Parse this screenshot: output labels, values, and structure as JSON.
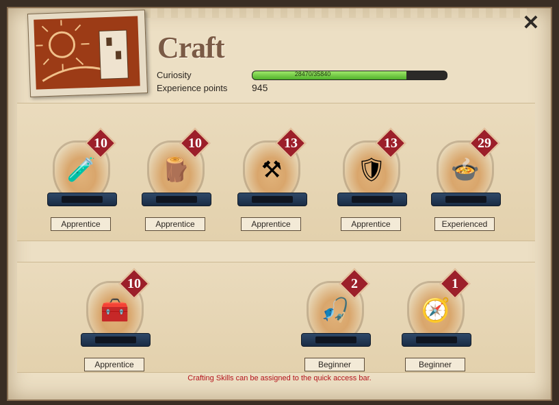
{
  "window": {
    "title": "Craft",
    "close_label": "✕",
    "curiosity_label": "Curiosity",
    "experience_label": "Experience points",
    "experience_value": "945",
    "curiosity_bar_text": "28470/35840",
    "curiosity_fraction": 0.794
  },
  "skills_row1": [
    {
      "level": "10",
      "rank": "Apprentice",
      "icon": "potion-icon"
    },
    {
      "level": "10",
      "rank": "Apprentice",
      "icon": "lumber-icon"
    },
    {
      "level": "13",
      "rank": "Apprentice",
      "icon": "anvil-icon"
    },
    {
      "level": "13",
      "rank": "Apprentice",
      "icon": "armor-icon"
    },
    {
      "level": "29",
      "rank": "Experienced",
      "icon": "food-dish-icon"
    }
  ],
  "skills_row2": [
    {
      "level": "10",
      "rank": "Apprentice",
      "icon": "treasure-chest-icon"
    },
    {
      "level": "2",
      "rank": "Beginner",
      "icon": "fishing-rod-icon"
    },
    {
      "level": "1",
      "rank": "Beginner",
      "icon": "compass-icon"
    }
  ],
  "footer_note": "Crafting Skills can be assigned to the quick access bar."
}
